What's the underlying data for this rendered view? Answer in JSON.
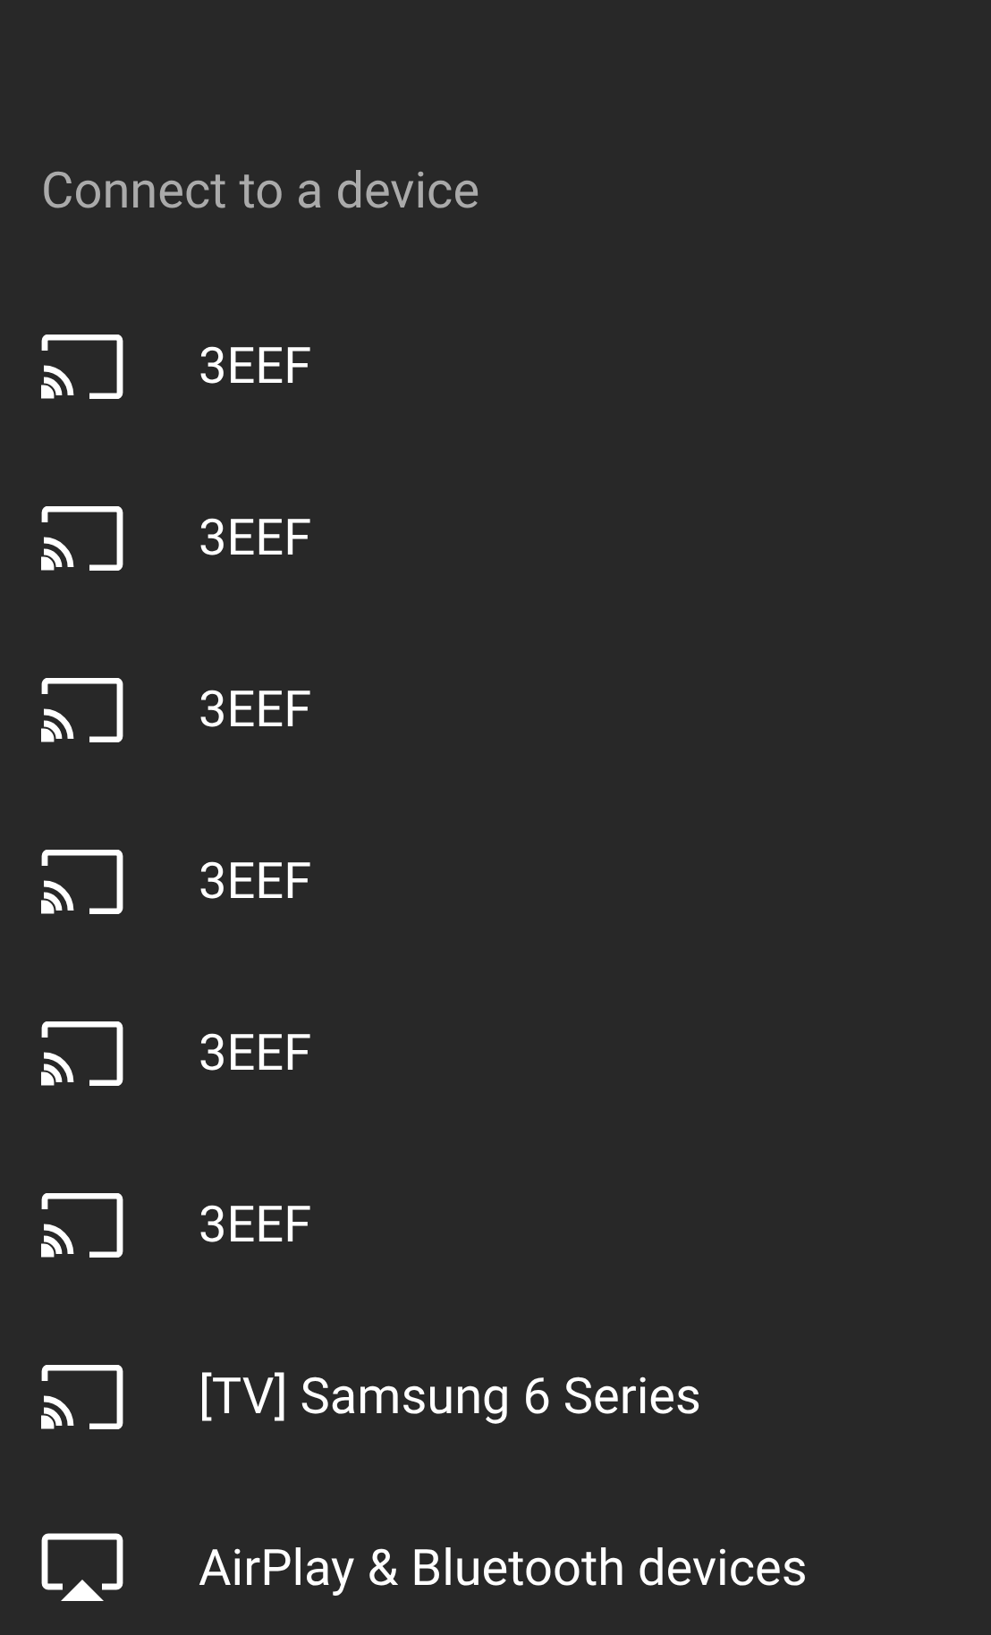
{
  "title": "Connect to a device",
  "devices": [
    {
      "kind": "cast",
      "name": "3EEF"
    },
    {
      "kind": "cast",
      "name": "3EEF"
    },
    {
      "kind": "cast",
      "name": "3EEF"
    },
    {
      "kind": "cast",
      "name": "3EEF"
    },
    {
      "kind": "cast",
      "name": "3EEF"
    },
    {
      "kind": "cast",
      "name": "3EEF"
    },
    {
      "kind": "cast",
      "name": "[TV] Samsung 6 Series"
    },
    {
      "kind": "airplay",
      "name": "AirPlay & Bluetooth devices"
    }
  ]
}
